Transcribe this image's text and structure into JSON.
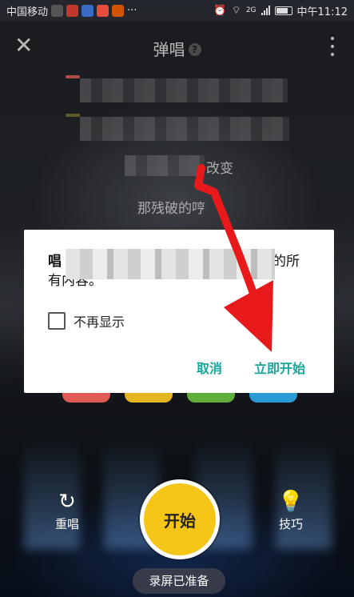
{
  "status_bar": {
    "carrier": "中国移动",
    "network": "2G",
    "time": "中午11:12",
    "more": "···"
  },
  "header": {
    "title": "弹唱"
  },
  "lyrics": {
    "line3_visible": "改变",
    "line4_visible": "那残破的哼"
  },
  "dialog": {
    "message_prefix": "唱",
    "message_suffix": "的所",
    "message_line2": "有内容。",
    "checkbox_label": "不再显示",
    "cancel_label": "取消",
    "confirm_label": "立即开始"
  },
  "controls": {
    "retry_label": "重唱",
    "start_label": "开始",
    "tips_label": "技巧",
    "status_label": "录屏已准备"
  },
  "colors": {
    "accent": "#1aa59a",
    "start": "#f5c518",
    "annotation": "#e8191b"
  }
}
